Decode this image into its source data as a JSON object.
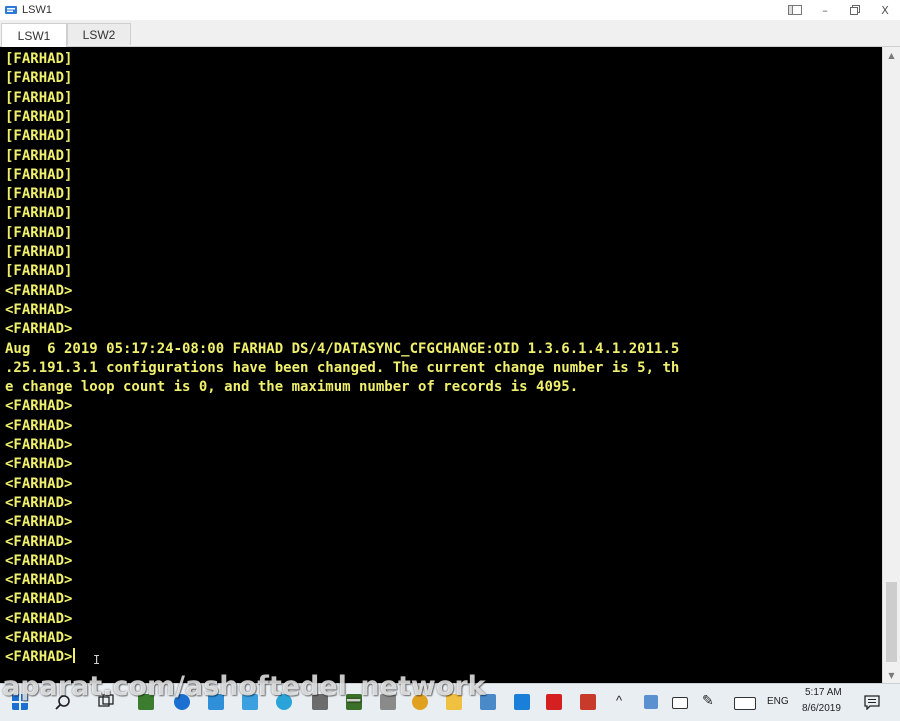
{
  "window": {
    "title": "LSW1",
    "controls": {
      "restore_icon": "restore-icon",
      "minimize": "–",
      "maximize": "🗗",
      "close": "X"
    }
  },
  "tabs": [
    {
      "label": "LSW1",
      "active": true
    },
    {
      "label": "LSW2",
      "active": false
    }
  ],
  "terminal": {
    "text_color": "#f0f06e",
    "background": "#000000",
    "lines": [
      "[FARHAD]",
      "[FARHAD]",
      "[FARHAD]",
      "[FARHAD]",
      "[FARHAD]",
      "[FARHAD]",
      "[FARHAD]",
      "[FARHAD]",
      "[FARHAD]",
      "[FARHAD]",
      "[FARHAD]",
      "[FARHAD]",
      "<FARHAD>",
      "<FARHAD>",
      "<FARHAD>",
      "Aug  6 2019 05:17:24-08:00 FARHAD DS/4/DATASYNC_CFGCHANGE:OID 1.3.6.1.4.1.2011.5",
      ".25.191.3.1 configurations have been changed. The current change number is 5, th",
      "e change loop count is 0, and the maximum number of records is 4095.",
      "<FARHAD>",
      "<FARHAD>",
      "<FARHAD>",
      "<FARHAD>",
      "<FARHAD>",
      "<FARHAD>",
      "<FARHAD>",
      "<FARHAD>",
      "<FARHAD>",
      "<FARHAD>",
      "<FARHAD>",
      "<FARHAD>",
      "<FARHAD>",
      "<FARHAD>"
    ]
  },
  "watermark": "aparat.com/ashoftedel_network",
  "taskbar": {
    "language": "ENG",
    "time": "5:17 AM",
    "date": "8/6/2019"
  }
}
